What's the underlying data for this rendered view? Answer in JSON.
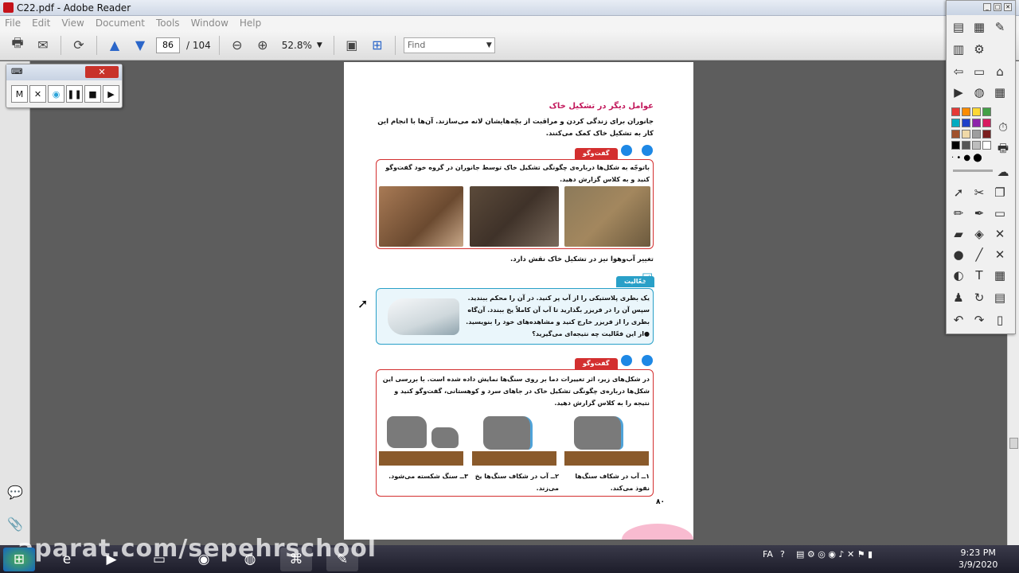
{
  "window": {
    "title": "C22.pdf - Adobe Reader"
  },
  "menu": [
    "File",
    "Edit",
    "View",
    "Document",
    "Tools",
    "Window",
    "Help"
  ],
  "toolbar": {
    "page_current": "86",
    "page_total": "/ 104",
    "zoom": "52.8%",
    "find_placeholder": "Find"
  },
  "recorder": {
    "buttons": [
      "M",
      "✕",
      "◉",
      "❚❚",
      "■",
      "▶"
    ]
  },
  "document": {
    "heading": "عوامل دیگر در تشکیل خاک",
    "intro": "جانوران برای زندگی کردن و مراقبت از بچّه‌هایشان لانه می‌سازند. آن‌ها با انجام این کار به تشکیل خاک کمک می‌کنند.",
    "box1_tag": "گفت‌وگو",
    "box1_text": "باتوجّه به شکل‌ها درباره‌ی چگونگی تشکیل خاک توسط جانوران در گروه خود گفت‌وگو کنید و به کلاس گزارش دهید.",
    "climate_text": "تغییر آب‌وهوا نیز در تشکیل خاک نقش دارد.",
    "box2_tag": "فعّالیت",
    "box2_lines": [
      "یک بطری پلاستیکی را از آب پر کنید. در آن را محکم ببندید.",
      "سپس آن را در فریزر بگذارید تا  آب آن کاملاً یخ ببندد. آن‌گاه",
      "بطری را از فریزر خارج کنید و مشاهده‌های خود را بنویسید.",
      "●از این فعّالیت چه نتیجه‌ای می‌گیرید؟"
    ],
    "box3_tag": "گفت‌وگو",
    "box3_text": "در شکل‌های زیر، اثر تغییرات دما بر روی سنگ‌ها نمایش داده شده است. با بررسی این شکل‌ها درباره‌ی چگونگی تشکیل خاک در جاهای سرد و کوهستانی، گفت‌وگو کنید و نتیجه را به کلاس گزارش دهید.",
    "captions": [
      "۱ــ آب در شکاف سنگ‌ها نفوذ می‌کند.",
      "۲ــ آب در شکاف سنگ‌ها یخ می‌زند.",
      "۳ــ سنگ شکسته می‌شود."
    ],
    "page_number": "۸۰"
  },
  "taskbar": {
    "watermark": "aparat.com/sepehrschool",
    "language": "FA",
    "time": "9:23 PM",
    "date": "3/9/2020"
  },
  "colors": {
    "heading": "#c2185b",
    "talk_border": "#d32f2f",
    "activity_border": "#29a0c8"
  }
}
